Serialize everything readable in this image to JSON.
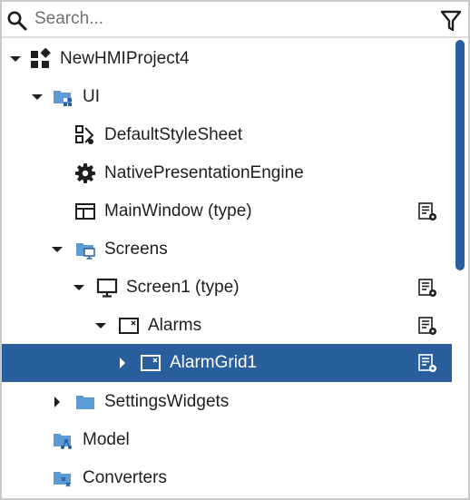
{
  "search": {
    "placeholder": "Search..."
  },
  "colors": {
    "selection": "#2a5f9e",
    "folder": "#5c9bd6",
    "icon_dark": "#1e1e1e",
    "scrollbar": "#2a5f9e"
  },
  "tree": [
    {
      "label": "NewHMIProject4",
      "expanded": true,
      "icon": "project-icon"
    },
    {
      "label": "UI",
      "expanded": true,
      "icon": "ui-folder-icon"
    },
    {
      "label": "DefaultStyleSheet",
      "icon": "style-sheet-icon"
    },
    {
      "label": "NativePresentationEngine",
      "icon": "gear-icon"
    },
    {
      "label": "MainWindow (type)",
      "icon": "window-icon",
      "tail_icon": "properties-icon"
    },
    {
      "label": "Screens",
      "expanded": true,
      "icon": "screens-folder-icon"
    },
    {
      "label": "Screen1 (type)",
      "expanded": true,
      "icon": "monitor-icon",
      "tail_icon": "properties-icon"
    },
    {
      "label": "Alarms",
      "expanded": true,
      "icon": "widget-icon",
      "tail_icon": "properties-icon"
    },
    {
      "label": "AlarmGrid1",
      "expanded": false,
      "selected": true,
      "icon": "widget-icon",
      "tail_icon": "properties-icon"
    },
    {
      "label": "SettingsWidgets",
      "expanded": false,
      "icon": "folder-icon"
    },
    {
      "label": "Model",
      "icon": "model-folder-icon"
    },
    {
      "label": "Converters",
      "icon": "converters-folder-icon"
    }
  ]
}
